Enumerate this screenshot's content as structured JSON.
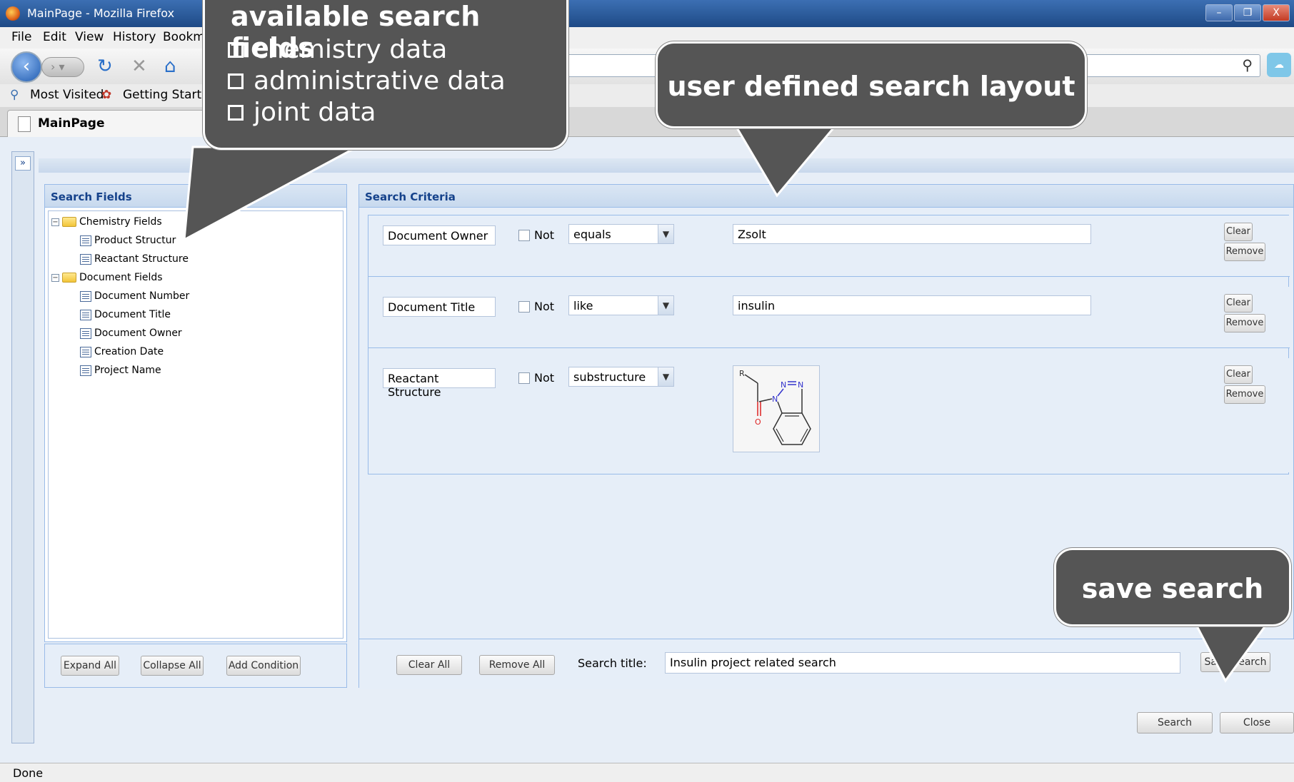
{
  "window": {
    "title": "MainPage - Mozilla Firefox",
    "controls": [
      "–",
      "❐",
      "X"
    ]
  },
  "menu": [
    "File",
    "Edit",
    "View",
    "History",
    "Bookm"
  ],
  "bookmarks": [
    "Most Visited",
    "Getting Startec"
  ],
  "tab": {
    "title": "MainPage"
  },
  "search_fields": {
    "header": "Search Fields",
    "tree": [
      {
        "label": "Chemistry Fields",
        "children": [
          "Product Structur",
          "Reactant Structure"
        ]
      },
      {
        "label": "Document Fields",
        "children": [
          "Document Number",
          "Document Title",
          "Document Owner",
          "Creation Date",
          "Project Name"
        ]
      }
    ],
    "buttons": {
      "expand_all": "Expand All",
      "collapse_all": "Collapse All",
      "add_condition": "Add Condition"
    }
  },
  "search_criteria": {
    "header": "Search Criteria",
    "rows": [
      {
        "field": "Document Owner",
        "not_label": "Not",
        "operator": "equals",
        "value": "Zsolt"
      },
      {
        "field": "Document Title",
        "not_label": "Not",
        "operator": "like",
        "value": "insulin"
      },
      {
        "field": "Reactant Structure",
        "not_label": "Not",
        "operator": "substructure",
        "value": ""
      }
    ],
    "row_buttons": {
      "clear": "Clear",
      "remove": "Remove"
    },
    "structure_labels": {
      "r": "R",
      "n": "N",
      "o": "O"
    },
    "bottom": {
      "clear_all": "Clear All",
      "remove_all": "Remove All",
      "title_label": "Search title:",
      "title_value": "Insulin project related search",
      "save_search": "Save Search"
    }
  },
  "footer_buttons": {
    "search": "Search",
    "close": "Close"
  },
  "status": "Done",
  "callouts": {
    "fields": {
      "title": "available search fields",
      "items": [
        "chemistry data",
        "administrative data",
        "joint data"
      ]
    },
    "layout": "user defined search layout",
    "save": "save search"
  }
}
